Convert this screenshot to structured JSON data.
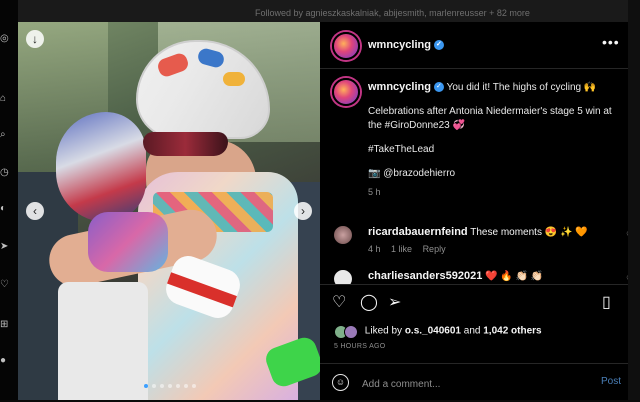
{
  "background": {
    "followed_by": "Followed by agnieszkaskalniak, abijesmith, marlenreusser + 82 more"
  },
  "post": {
    "username": "wmncycling",
    "carousel": {
      "slide_count": 7,
      "active_index": 0
    }
  },
  "caption": {
    "username": "wmncycling",
    "line1": "You did it! The highs of cycling 🙌",
    "line2": "Celebrations after Antonia Niedermaier's stage 5 win at the #GiroDonne23 💞",
    "line3": "#TakeTheLead",
    "line4": "📷 @brazodehierro",
    "time": "5 h"
  },
  "comments": [
    {
      "username": "ricardabauernfeind",
      "text": "These moments 😍 ✨ 🧡",
      "time": "4 h",
      "likes": "1 like",
      "reply": "Reply"
    },
    {
      "username": "charliesanders592021",
      "text": "❤️ 🔥 👏🏻 👏🏻",
      "time": "",
      "likes": "",
      "reply": ""
    }
  ],
  "likes": {
    "prefix": "Liked by",
    "user": "o.s._040601",
    "conj": "and",
    "others": "1,042 others",
    "ago": "5 HOURS AGO"
  },
  "composer": {
    "placeholder": "Add a comment...",
    "post_label": "Post"
  },
  "icons": {
    "more": "more-horizontal-icon",
    "like": "heart-outline-icon",
    "comment": "comment-bubble-icon",
    "share": "paper-plane-icon",
    "save": "bookmark-outline-icon",
    "emoji": "emoji-smiley-icon"
  },
  "colors": {
    "modal_bg": "#000000",
    "text": "#f5f5f5",
    "muted": "#8e8e8e",
    "verified": "#3b97f0",
    "post_link": "#4a7fb8",
    "carousel_active_dot": "#3da0ff",
    "emoji_heart": "#ed4956"
  }
}
